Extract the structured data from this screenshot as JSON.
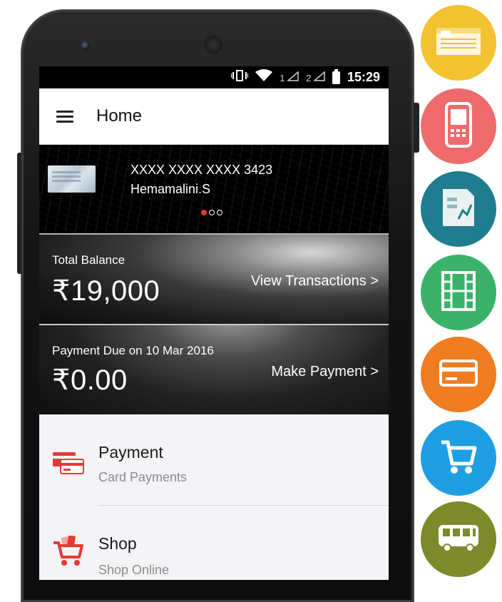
{
  "statusbar": {
    "sim1": "1",
    "sim2": "2",
    "time": "15:29"
  },
  "appbar": {
    "title": "Home"
  },
  "card": {
    "number": "XXXX XXXX XXXX 3423",
    "holder": "Hemamalini.S",
    "pager_total": 3,
    "pager_active": 0
  },
  "balance": {
    "label": "Total Balance",
    "amount": "₹19,000",
    "link": "View Transactions >"
  },
  "due": {
    "label": "Payment Due on 10 Mar 2016",
    "amount": "₹0.00",
    "link": "Make Payment >"
  },
  "menu": [
    {
      "title": "Payment",
      "subtitle": "Card Payments",
      "icon": "card-payment-icon"
    },
    {
      "title": "Shop",
      "subtitle": "Shop Online",
      "icon": "shopping-cart-icon"
    }
  ],
  "features": [
    {
      "icon": "cheque-icon",
      "color": "#f2c230"
    },
    {
      "icon": "mobile-phone-icon",
      "color": "#ef6b6b"
    },
    {
      "icon": "bill-chart-icon",
      "color": "#1f7d8f"
    },
    {
      "icon": "film-icon",
      "color": "#3ab26a"
    },
    {
      "icon": "credit-card-icon",
      "color": "#f07c22"
    },
    {
      "icon": "shopping-cart-icon",
      "color": "#1e9ee3"
    },
    {
      "icon": "bus-icon",
      "color": "#7c8a2a"
    }
  ],
  "colors": {
    "accent": "#e53935",
    "appbar": "#ffffff",
    "statusbar": "#000000"
  }
}
